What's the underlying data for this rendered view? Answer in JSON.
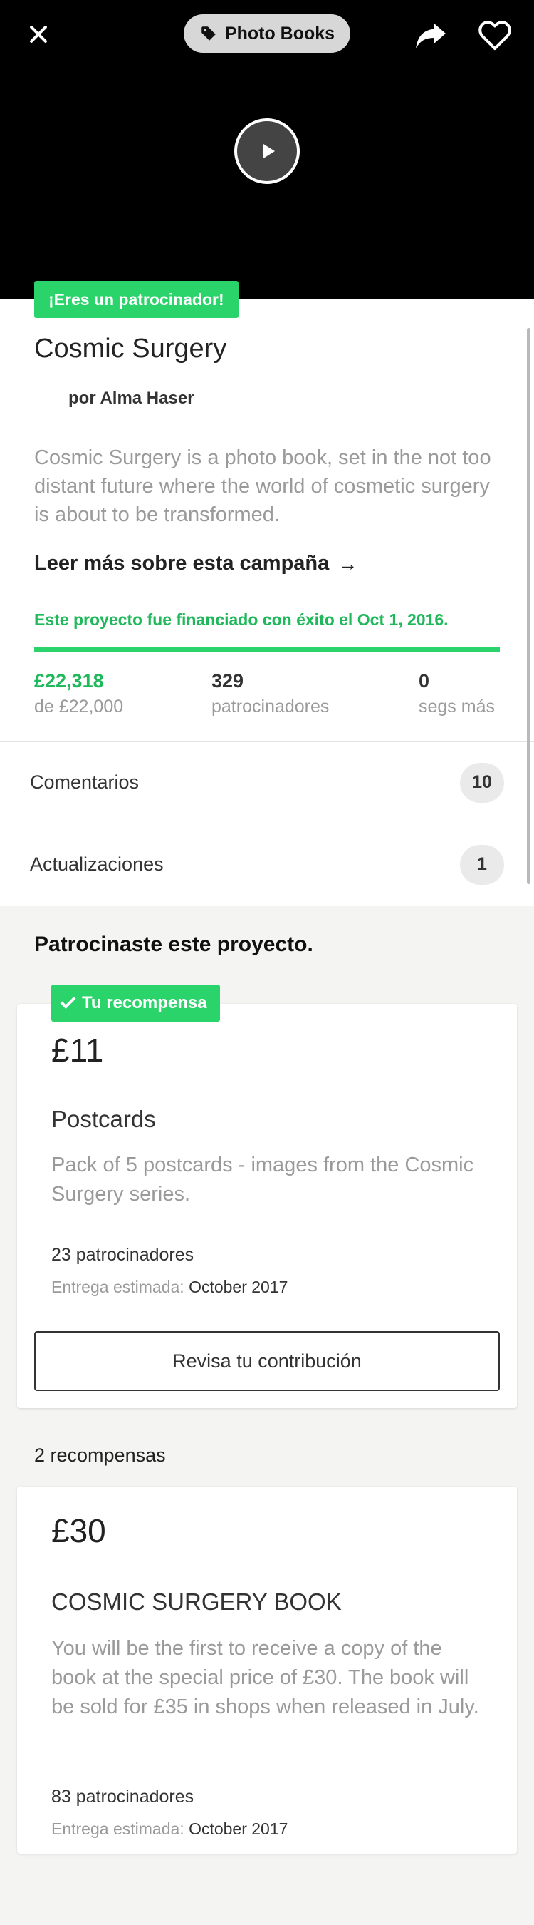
{
  "header": {
    "category": "Photo Books"
  },
  "project": {
    "backer_badge": "¡Eres un patrocinador!",
    "title": "Cosmic Surgery",
    "byline": "por Alma Haser",
    "blurb": "Cosmic Surgery is a photo book, set in the not too distant future where the world of cosmetic surgery is about to be transformed.",
    "read_more": "Leer más sobre esta campaña",
    "funded_text": "Este proyecto fue financiado con éxito el Oct 1, 2016.",
    "progress_fraction": 1.0,
    "stats": {
      "pledged_value": "£22,318",
      "pledged_label": "de £22,000",
      "backers_value": "329",
      "backers_label": "patrocinadores",
      "time_value": "0",
      "time_label": "segs más"
    }
  },
  "lists": {
    "comments_label": "Comentarios",
    "comments_count": "10",
    "updates_label": "Actualizaciones",
    "updates_count": "1"
  },
  "backed": {
    "title": "Patrocinaste este proyecto.",
    "badge": "Tu recompensa",
    "amount": "£11",
    "name": "Postcards",
    "description": "Pack of 5 postcards - images from the Cosmic Surgery series.",
    "backers": "23 patrocinadores",
    "delivery_label": "Entrega estimada:",
    "delivery_date": "October 2017",
    "review_button": "Revisa tu contribución"
  },
  "rewards": {
    "count_label": "2 recompensas",
    "items": [
      {
        "amount": "£30",
        "name": "COSMIC SURGERY BOOK",
        "description": "You will be the first to receive a copy of the book at the special price of £30. The book will be sold for £35 in shops when released in July.",
        "backers": "83 patrocinadores",
        "delivery_label": "Entrega estimada:",
        "delivery_date": "October 2017"
      }
    ]
  },
  "colors": {
    "accent_green": "#2bd46b",
    "text_green": "#1fb85a"
  },
  "icons": [
    "close-icon",
    "tag-icon",
    "share-icon",
    "heart-icon",
    "play-icon",
    "arrow-right-icon",
    "checkmark-icon"
  ]
}
